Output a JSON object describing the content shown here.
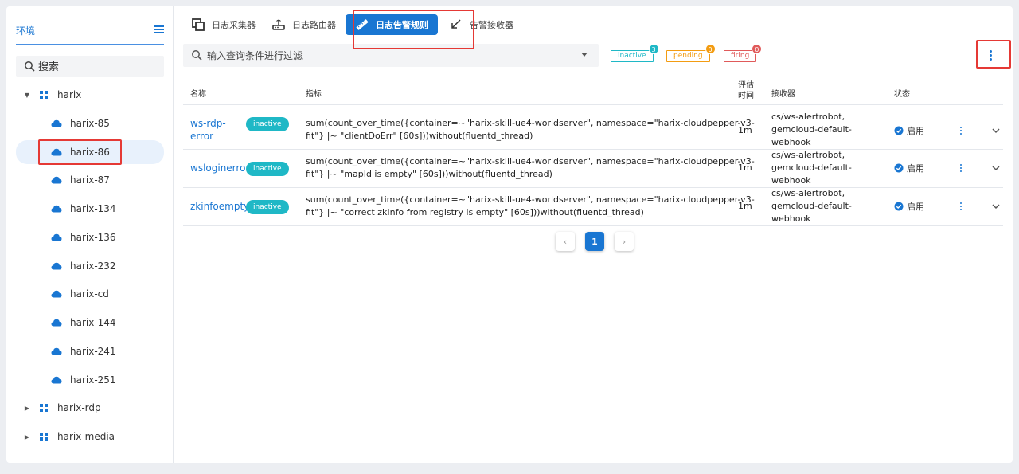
{
  "sidebar": {
    "title": "环境",
    "search_placeholder": "搜索",
    "tree": [
      {
        "label": "harix",
        "type": "group",
        "expanded": true
      },
      {
        "label": "harix-85",
        "type": "leaf"
      },
      {
        "label": "harix-86",
        "type": "leaf",
        "selected": true
      },
      {
        "label": "harix-87",
        "type": "leaf"
      },
      {
        "label": "harix-134",
        "type": "leaf"
      },
      {
        "label": "harix-136",
        "type": "leaf"
      },
      {
        "label": "harix-232",
        "type": "leaf"
      },
      {
        "label": "harix-cd",
        "type": "leaf"
      },
      {
        "label": "harix-144",
        "type": "leaf"
      },
      {
        "label": "harix-241",
        "type": "leaf"
      },
      {
        "label": "harix-251",
        "type": "leaf"
      },
      {
        "label": "harix-rdp",
        "type": "group",
        "expanded": false
      },
      {
        "label": "harix-media",
        "type": "group",
        "expanded": false
      }
    ]
  },
  "tabs": [
    {
      "label": "日志采集器",
      "icon": "collector-icon"
    },
    {
      "label": "日志路由器",
      "icon": "router-icon"
    },
    {
      "label": "日志告警规则",
      "icon": "ruler-icon",
      "active": true
    },
    {
      "label": "告警接收器",
      "icon": "receiver-icon"
    }
  ],
  "filter": {
    "placeholder": "输入查询条件进行过滤"
  },
  "chips": [
    {
      "label": "inactive",
      "count": "3",
      "color": "#1fb8c6"
    },
    {
      "label": "pending",
      "count": "0",
      "color": "#f39c12"
    },
    {
      "label": "firing",
      "count": "0",
      "color": "#e05a5a"
    }
  ],
  "table": {
    "headers": {
      "name": "名称",
      "metric": "指标",
      "eval_line1": "评估",
      "eval_line2": "时间",
      "receiver": "接收器",
      "status": "状态"
    },
    "rows": [
      {
        "name_line1": "ws-rdp-",
        "name_line2": "error",
        "state": "inactive",
        "metric_line1": "sum(count_over_time({container=~\"harix-skill-ue4-worldserver\", namespace=\"harix-cloudpepper-v3-",
        "metric_line2": "fit\"} |~ \"clientDoErr\" [60s]))without(fluentd_thread)",
        "eval": "1m",
        "receiver_line1": "cs/ws-alertrobot,",
        "receiver_line2": "gemcloud-default-",
        "receiver_line3": "webhook",
        "status": "启用"
      },
      {
        "name_line1": "wsloginerror",
        "name_line2": "",
        "state": "inactive",
        "metric_line1": "sum(count_over_time({container=~\"harix-skill-ue4-worldserver\", namespace=\"harix-cloudpepper-v3-",
        "metric_line2": "fit\"} |~ \"mapId is empty\" [60s]))without(fluentd_thread)",
        "eval": "1m",
        "receiver_line1": "cs/ws-alertrobot,",
        "receiver_line2": "gemcloud-default-",
        "receiver_line3": "webhook",
        "status": "启用"
      },
      {
        "name_line1": "zkinfoempty",
        "name_line2": "",
        "state": "inactive",
        "metric_line1": "sum(count_over_time({container=~\"harix-skill-ue4-worldserver\", namespace=\"harix-cloudpepper-v3-",
        "metric_line2": "fit\"} |~ \"correct zkInfo from registry is empty\" [60s]))without(fluentd_thread)",
        "eval": "1m",
        "receiver_line1": "cs/ws-alertrobot,",
        "receiver_line2": "gemcloud-default-",
        "receiver_line3": "webhook",
        "status": "启用"
      }
    ]
  },
  "pagination": {
    "current": "1",
    "prev": "‹",
    "next": "›"
  }
}
